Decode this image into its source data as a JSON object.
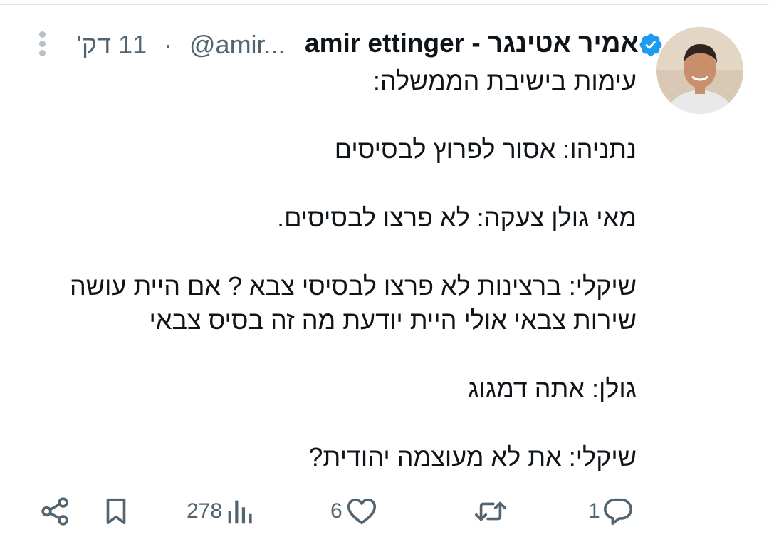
{
  "tweet": {
    "author": {
      "display_name": "amir ettinger - אמיר אטינגר",
      "handle": "@amir...",
      "verified": true
    },
    "time": "11 דק'",
    "separator": "·",
    "body": [
      "עימות בישיבת הממשלה:",
      "",
      "נתניהו: אסור לפרוץ לבסיסים",
      "",
      "מאי גולן צעקה: לא פרצו לבסיסים.",
      "",
      "שיקלי: ברצינות לא פרצו לבסיסי צבא ? אם היית עושה",
      "שירות צבאי אולי היית יודעת מה זה בסיס צבאי",
      "",
      "גולן: אתה דמגוג",
      "",
      "שיקלי: את לא מעוצמה יהודית?"
    ],
    "actions": {
      "reply_count": "1",
      "retweet_count": "",
      "like_count": "6",
      "view_count": "278"
    }
  },
  "icons": {
    "verified": "verified-badge-icon",
    "more": "more-vertical-icon",
    "reply": "reply-icon",
    "retweet": "retweet-icon",
    "like": "heart-icon",
    "views": "views-chart-icon",
    "bookmark": "bookmark-icon",
    "share": "share-icon"
  },
  "colors": {
    "text_primary": "#0f1419",
    "text_secondary": "#536471",
    "verified_blue": "#1d9bf0",
    "divider": "#e4e7ea"
  }
}
